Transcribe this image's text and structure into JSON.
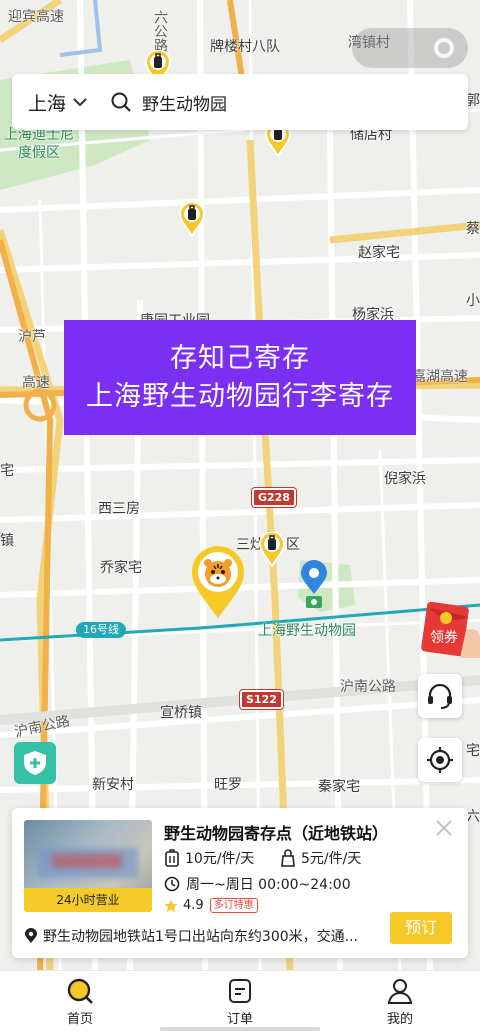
{
  "map": {
    "labels": {
      "yingbin_road": "迎宾高速",
      "paifang_village": "牌楼村八队",
      "wanzhen_village": "湾镇村",
      "resort_l1": "上海迪士尼",
      "resort_l2": "度假区",
      "zhujia": "储店村",
      "zhaojia": "赵家宅",
      "yangjia": "杨家浜",
      "xiaoyuan": "康园工业园",
      "hulu_road_l1": "沪芦",
      "hulu_road_l2": "高速",
      "huhu_road": "嘉湖高速",
      "nijia": "倪家浜",
      "xisanfang": "西三房",
      "sanzao": "三灶",
      "zhen": "镇",
      "qiaojia": "乔家宅",
      "zoo": "上海野生动物园",
      "hunan_road_1": "沪南公路",
      "hunan_road_2": "沪南公路",
      "xuanqiao": "宣桥镇",
      "xinan": "新安村",
      "wangluo": "旺罗",
      "qinjia": "秦家宅",
      "liu_road": "六公路",
      "qu": "区",
      "liu2": "六",
      "xiao": "小",
      "edge1": "郭",
      "edge2": "蔡",
      "edge3": "宅",
      "edge4": "宅"
    },
    "road_badges": {
      "g228": "G228",
      "s122": "S122"
    },
    "metro_badge": "16号线"
  },
  "search": {
    "city": "上海",
    "query": "野生动物园"
  },
  "banner": {
    "line1": "存知己寄存",
    "line2": "上海野生动物园行李寄存"
  },
  "coupon_label": "领券",
  "store": {
    "name": "野生动物园寄存点（近地铁站）",
    "hours_tag": "24小时营业",
    "price_large": "10元/件/天",
    "price_small": "5元/件/天",
    "hours": "周一~周日 00:00~24:00",
    "rating": "4.9",
    "rating_badge": "多订特惠",
    "address": "野生动物园地铁站1号口出站向东约300米，交通...",
    "book_label": "预订"
  },
  "tabs": [
    {
      "label": "首页"
    },
    {
      "label": "订单"
    },
    {
      "label": "我的"
    }
  ],
  "colors": {
    "accent": "#f6c929",
    "banner": "#7a2ff3",
    "shield": "#36c0a6",
    "metro": "#22a8b8",
    "road_red": "#c4392f"
  }
}
